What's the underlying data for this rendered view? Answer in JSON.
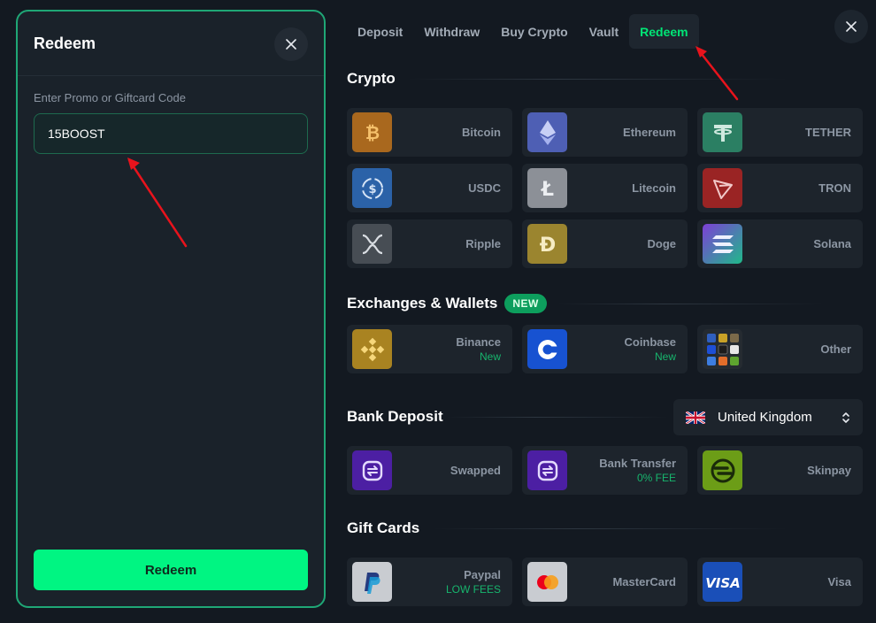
{
  "redeem_panel": {
    "title": "Redeem",
    "input_label": "Enter Promo or Giftcard Code",
    "input_value": "15BOOST",
    "button_label": "Redeem"
  },
  "tabs": [
    {
      "label": "Deposit"
    },
    {
      "label": "Withdraw"
    },
    {
      "label": "Buy Crypto"
    },
    {
      "label": "Vault"
    },
    {
      "label": "Redeem",
      "active": true
    }
  ],
  "sections": {
    "crypto": {
      "title": "Crypto"
    },
    "exchanges": {
      "title": "Exchanges & Wallets",
      "badge": "NEW"
    },
    "bank": {
      "title": "Bank Deposit"
    },
    "gift": {
      "title": "Gift Cards"
    }
  },
  "crypto": [
    {
      "name": "Bitcoin",
      "icon": "bitcoin-icon",
      "color": "#f7931a"
    },
    {
      "name": "Ethereum",
      "icon": "ethereum-icon",
      "color": "#627eea"
    },
    {
      "name": "TETHER",
      "icon": "tether-icon",
      "color": "#26a17b"
    },
    {
      "name": "USDC",
      "icon": "usdc-icon",
      "color": "#2775ca"
    },
    {
      "name": "Litecoin",
      "icon": "litecoin-icon",
      "color": "#bfbbbb"
    },
    {
      "name": "TRON",
      "icon": "tron-icon",
      "color": "#e50914"
    },
    {
      "name": "Ripple",
      "icon": "ripple-icon",
      "color": "#5c6670"
    },
    {
      "name": "Doge",
      "icon": "doge-icon",
      "color": "#c2a633"
    },
    {
      "name": "Solana",
      "icon": "solana-icon",
      "color": "#9945ff"
    }
  ],
  "exchanges": [
    {
      "name": "Binance",
      "sub": "New",
      "icon": "binance-icon",
      "color": "#f0b90b"
    },
    {
      "name": "Coinbase",
      "sub": "New",
      "icon": "coinbase-icon",
      "color": "#0052ff"
    },
    {
      "name": "Other",
      "icon": "other-wallets-icon"
    }
  ],
  "bank": [
    {
      "name": "Swapped",
      "icon": "swapped-icon",
      "color": "#6c2bd9"
    },
    {
      "name": "Bank Transfer",
      "sub": "0% FEE",
      "icon": "bank-transfer-icon",
      "color": "#6c2bd9"
    },
    {
      "name": "Skinpay",
      "icon": "skinpay-icon",
      "color": "#86c51d"
    }
  ],
  "country": {
    "name": "United Kingdom",
    "icon": "uk-flag-icon"
  },
  "gift": [
    {
      "name": "Paypal",
      "sub": "LOW FEES",
      "icon": "paypal-icon",
      "color": "#e7e9ec"
    },
    {
      "name": "MasterCard",
      "icon": "mastercard-icon",
      "color": "#e7e9ec"
    },
    {
      "name": "Visa",
      "icon": "visa-icon",
      "color": "#1a4fb8"
    }
  ]
}
